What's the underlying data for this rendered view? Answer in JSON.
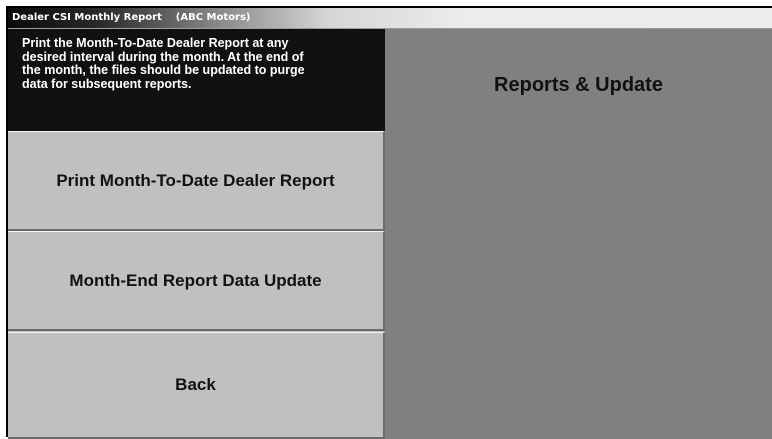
{
  "window": {
    "title": "Dealer CSI Monthly Report    (ABC Motors)"
  },
  "info": {
    "lines": [
      "Print the  Month-To-Date  Dealer Report at any",
      "desired interval during the month.  At the end of",
      "the month, the files should be updated to purge",
      "data for subsequent reports."
    ]
  },
  "menu": {
    "print_label": "Print Month-To-Date Dealer Report",
    "update_label": "Month-End Report Data Update",
    "back_label": "Back"
  },
  "panel": {
    "heading": "Reports & Update"
  },
  "colors": {
    "info_background": "#111111",
    "button_face": "#c0c0c0",
    "panel_background": "#808080"
  }
}
